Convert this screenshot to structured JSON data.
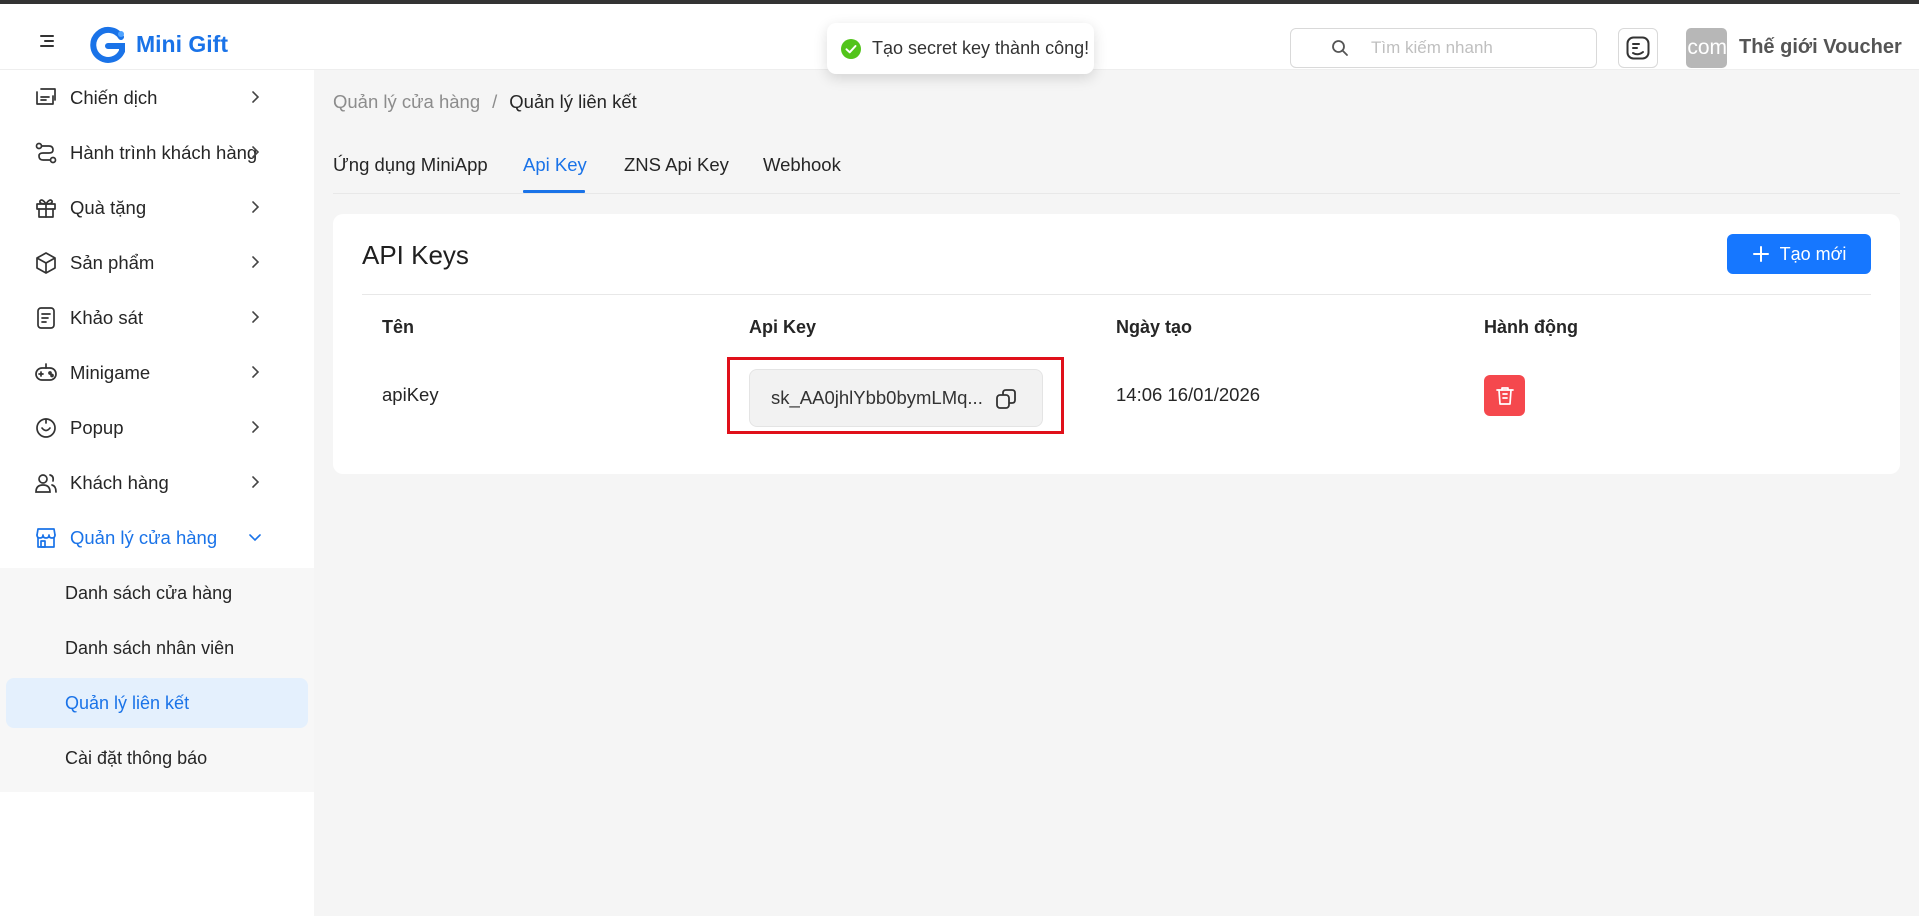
{
  "app": {
    "name": "Mini Gift"
  },
  "toast": {
    "message": "Tạo secret key thành công!",
    "status_color": "#52c41a"
  },
  "search": {
    "placeholder": "Tìm kiếm nhanh",
    "value": ""
  },
  "user": {
    "name": "Thế giới Voucher",
    "avatar_text": "com"
  },
  "sidebar": {
    "items": [
      {
        "label": "Chiến dịch",
        "icon": "campaign-icon"
      },
      {
        "label": "Hành trình khách hàng",
        "icon": "journey-icon"
      },
      {
        "label": "Quà tặng",
        "icon": "gift-icon"
      },
      {
        "label": "Sản phẩm",
        "icon": "product-box-icon"
      },
      {
        "label": "Khảo sát",
        "icon": "survey-icon"
      },
      {
        "label": "Minigame",
        "icon": "game-controller-icon"
      },
      {
        "label": "Popup",
        "icon": "popup-icon"
      },
      {
        "label": "Khách hàng",
        "icon": "customers-icon"
      },
      {
        "label": "Quản lý cửa hàng",
        "icon": "store-icon",
        "expanded": true
      }
    ],
    "submenu": [
      {
        "label": "Danh sách cửa hàng"
      },
      {
        "label": "Danh sách nhân viên"
      },
      {
        "label": "Quản lý liên kết",
        "active": true
      },
      {
        "label": "Cài đặt thông báo"
      }
    ]
  },
  "breadcrumb": {
    "parent": "Quản lý cửa hàng",
    "separator": "/",
    "current": "Quản lý liên kết"
  },
  "tabs": [
    {
      "label": "Ứng dụng MiniApp"
    },
    {
      "label": "Api Key",
      "active": true
    },
    {
      "label": "ZNS Api Key"
    },
    {
      "label": "Webhook"
    }
  ],
  "api_keys": {
    "title": "API Keys",
    "new_button": "Tạo mới",
    "columns": [
      "Tên",
      "Api Key",
      "Ngày tạo",
      "Hành động"
    ],
    "rows": [
      {
        "name": "apiKey",
        "key": "sk_AA0jhlYbb0bymLMq...",
        "created": "14:06 16/01/2026"
      }
    ]
  },
  "colors": {
    "accent": "#1677ff",
    "danger": "#f5484d",
    "highlight": "#e0101a"
  }
}
